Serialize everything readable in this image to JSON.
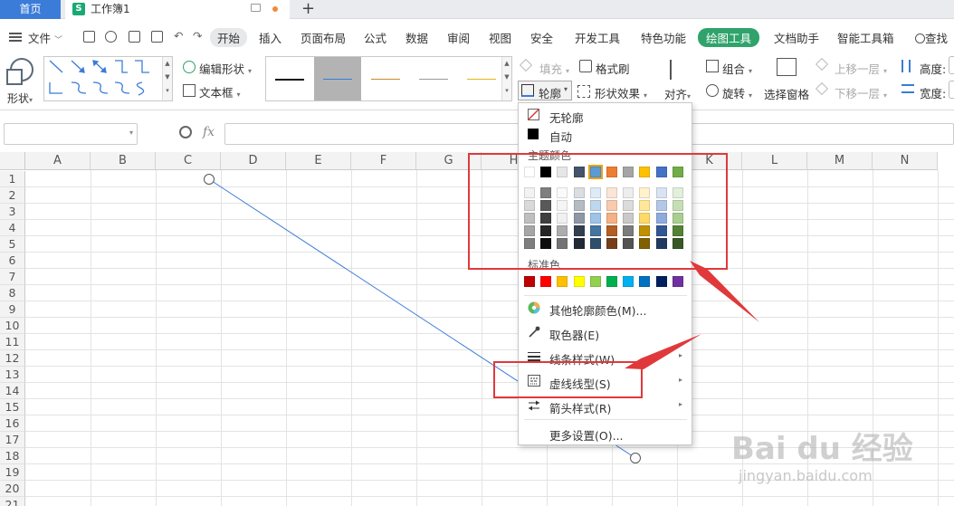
{
  "titlebar": {
    "home_tab": "首页",
    "doc_tab": "工作簿1",
    "new_tab": "+"
  },
  "menu": {
    "file": "文件",
    "items": [
      "开始",
      "插入",
      "页面布局",
      "公式",
      "数据",
      "审阅",
      "视图",
      "安全",
      "开发工具",
      "特色功能",
      "绘图工具",
      "文档助手",
      "智能工具箱"
    ],
    "search": "查找"
  },
  "ribbon": {
    "shape": "形状",
    "edit_shape": "编辑形状",
    "text_box": "文本框",
    "fill": "填充",
    "format_painter": "格式刷",
    "outline": "轮廓",
    "shape_effect": "形状效果",
    "align": "对齐",
    "group": "组合",
    "rotate": "旋转",
    "selection_pane": "选择窗格",
    "bring_forward": "上移一层",
    "send_backward": "下移一层",
    "height": "高度:",
    "width": "宽度:"
  },
  "formula_bar": {
    "fx": "fx"
  },
  "sheet": {
    "columns": [
      "A",
      "B",
      "C",
      "D",
      "E",
      "F",
      "G",
      "H",
      "I",
      "J",
      "K",
      "L",
      "M",
      "N"
    ],
    "rows": [
      "1",
      "2",
      "3",
      "4",
      "5",
      "6",
      "7",
      "8",
      "9",
      "10",
      "11",
      "12",
      "13",
      "14",
      "15",
      "16",
      "17",
      "18",
      "19",
      "20",
      "21"
    ]
  },
  "dropdown": {
    "no_outline": "无轮廓",
    "auto": "自动",
    "theme_colors_label": "主题颜色",
    "standard_colors_label": "标准色",
    "more_colors": "其他轮廓颜色(M)...",
    "eyedropper": "取色器(E)",
    "line_style": "线条样式(W)",
    "dash_type": "虚线线型(S)",
    "arrow_style": "箭头样式(R)",
    "more_settings": "更多设置(O)..."
  },
  "colors": {
    "accent_blue": "#3b7cd8",
    "drawing_tab_green": "#2fa36b",
    "annotation_red": "#e0393c",
    "theme_top": [
      "#ffffff",
      "#000000",
      "#e7e6e6",
      "#44546a",
      "#5b9bd5",
      "#ed7d31",
      "#a5a5a5",
      "#ffc000",
      "#4472c4",
      "#70ad47"
    ],
    "standard": [
      "#c00000",
      "#ff0000",
      "#ffc000",
      "#ffff00",
      "#92d050",
      "#00b050",
      "#00b0f0",
      "#0070c0",
      "#002060",
      "#7030a0"
    ]
  },
  "watermark": {
    "brand": "Bai du 经验",
    "url": "jingyan.baidu.com"
  }
}
